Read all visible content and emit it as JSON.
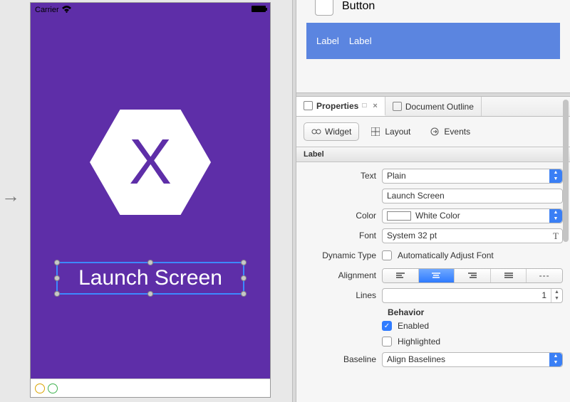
{
  "canvas": {
    "status_carrier": "Carrier",
    "label_text": "Launch Screen"
  },
  "toolbox": {
    "button_label": "Button",
    "label_item1": "Label",
    "label_item2": "Label"
  },
  "panel_tabs": {
    "properties": "Properties",
    "outline": "Document Outline"
  },
  "widget_tabs": {
    "widget": "Widget",
    "layout": "Layout",
    "events": "Events"
  },
  "section": {
    "label": "Label"
  },
  "props": {
    "text_label": "Text",
    "text_type": "Plain",
    "text_value": "Launch Screen",
    "color_label": "Color",
    "color_value": "White Color",
    "font_label": "Font",
    "font_value": "System 32 pt",
    "dyn_label": "Dynamic Type",
    "dyn_check": "Automatically Adjust Font",
    "align_label": "Alignment",
    "lines_label": "Lines",
    "lines_value": "1",
    "behavior": "Behavior",
    "enabled": "Enabled",
    "highlighted": "Highlighted",
    "baseline_label": "Baseline",
    "baseline_value": "Align Baselines"
  }
}
